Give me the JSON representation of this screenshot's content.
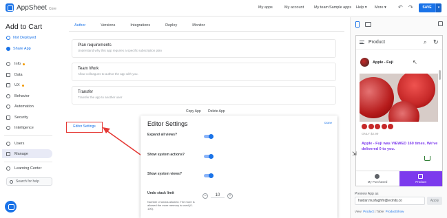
{
  "header": {
    "logo_text": "AppSheet",
    "logo_sub": "Core",
    "nav": [
      "My apps",
      "My account",
      "My team",
      "Sample apps",
      "Help",
      "More"
    ],
    "undo_icon": "undo-icon",
    "redo_icon": "redo-icon",
    "save_label": "SAVE",
    "save_dropdown": "▾",
    "accent_color": "#1a73e8"
  },
  "sidebar": {
    "app_title": "Add to Cart",
    "deploy_status": "Not Deployed",
    "share_label": "Share App",
    "items": [
      {
        "label": "Info",
        "icon": "info-icon",
        "dot": true
      },
      {
        "label": "Data",
        "icon": "data-icon",
        "dot": false
      },
      {
        "label": "UX",
        "icon": "ux-icon",
        "dot": true
      },
      {
        "label": "Behavior",
        "icon": "behavior-icon",
        "dot": false
      },
      {
        "label": "Automation",
        "icon": "automation-icon",
        "dot": false
      },
      {
        "label": "Security",
        "icon": "security-icon",
        "dot": false
      },
      {
        "label": "Intelligence",
        "icon": "intelligence-icon",
        "dot": false
      },
      {
        "label": "Users",
        "icon": "users-icon",
        "dot": false
      },
      {
        "label": "Manage",
        "icon": "manage-icon",
        "dot": false
      },
      {
        "label": "Learning Center",
        "icon": "learning-center-icon",
        "dot": false
      }
    ],
    "search_placeholder": "Search for help"
  },
  "main": {
    "tabs": [
      "Author",
      "Versions",
      "Integrations",
      "Deploy",
      "Monitor"
    ],
    "active_tab": "Author",
    "cards": [
      {
        "title": "Plan requirements",
        "desc": "Understand why this app requires a specific subscription plan"
      },
      {
        "title": "Team Work",
        "desc": "Allow colleagues to author the app with you."
      },
      {
        "title": "Transfer",
        "desc": "Transfer the app to another user"
      }
    ],
    "copy_app": "Copy App",
    "delete_app": "Delete App",
    "editor_settings_link": "Editor Settings"
  },
  "editor_settings": {
    "title": "Editor Settings",
    "done": "Done",
    "options": [
      {
        "label": "Expand all views?",
        "enabled": true
      },
      {
        "label": "Show system actions?",
        "enabled": true
      },
      {
        "label": "Show system views?",
        "enabled": true
      }
    ],
    "undo_label": "Undo stack limit",
    "undo_desc": "Number of undos allowed. The more is allowed the more memory is used (0-100).",
    "undo_value": "10",
    "minus": "−",
    "plus": "+"
  },
  "preview": {
    "header_title": "Product",
    "product_name": "Apple - Fuji",
    "price": "ONLY $2.99",
    "hearts": 5,
    "viewed_text": "Apple - Fuji was VIEWED 160 times. We've delivered 0 to you.",
    "nav": [
      {
        "label": "My Purchased",
        "icon": "person-icon"
      },
      {
        "label": "Product",
        "icon": "product-icon"
      }
    ],
    "active_nav": "Product",
    "accent_color": "#7c3aed",
    "preview_as_label": "Preview App as",
    "preview_as_value": "haidar.musfaghfir@exinity.co",
    "apply_label": "Apply",
    "view_label": "View:",
    "view_value": "Product",
    "table_label": "Table:",
    "table_value": "ProductShow"
  }
}
